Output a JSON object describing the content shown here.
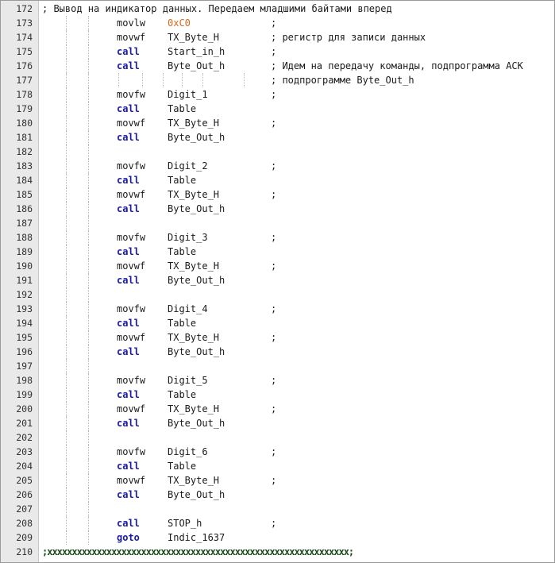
{
  "editor": {
    "accent_colors": {
      "keyword": "#1a1aa6",
      "hex_literal": "#d2691e"
    },
    "lines": [
      {
        "n": "172",
        "full": "; Вывод на индикатор данных. Передаем младшими байтами вперед"
      },
      {
        "n": "173",
        "i": "movlw",
        "o": "0xC0",
        "hex": true,
        "c": ";"
      },
      {
        "n": "174",
        "i": "movwf",
        "o": "TX_Byte_H",
        "c": "; регистр для записи данных"
      },
      {
        "n": "175",
        "i": "call",
        "o": "Start_in_h",
        "c": ";"
      },
      {
        "n": "176",
        "i": "call",
        "o": "Byte_Out_h",
        "c": "; Идем на передачу команды, подпрограмма АСК"
      },
      {
        "n": "177",
        "guides": true,
        "c": "; подпрограмме Byte_Out_h"
      },
      {
        "n": "178",
        "i": "movfw",
        "o": "Digit_1",
        "c": ";"
      },
      {
        "n": "179",
        "i": "call",
        "o": "Table"
      },
      {
        "n": "180",
        "i": "movwf",
        "o": "TX_Byte_H",
        "c": ";"
      },
      {
        "n": "181",
        "i": "call",
        "o": "Byte_Out_h"
      },
      {
        "n": "182"
      },
      {
        "n": "183",
        "i": "movfw",
        "o": "Digit_2",
        "c": ";"
      },
      {
        "n": "184",
        "i": "call",
        "o": "Table"
      },
      {
        "n": "185",
        "i": "movwf",
        "o": "TX_Byte_H",
        "c": ";"
      },
      {
        "n": "186",
        "i": "call",
        "o": "Byte_Out_h"
      },
      {
        "n": "187"
      },
      {
        "n": "188",
        "i": "movfw",
        "o": "Digit_3",
        "c": ";"
      },
      {
        "n": "189",
        "i": "call",
        "o": "Table"
      },
      {
        "n": "190",
        "i": "movwf",
        "o": "TX_Byte_H",
        "c": ";"
      },
      {
        "n": "191",
        "i": "call",
        "o": "Byte_Out_h"
      },
      {
        "n": "192"
      },
      {
        "n": "193",
        "i": "movfw",
        "o": "Digit_4",
        "c": ";"
      },
      {
        "n": "194",
        "i": "call",
        "o": "Table"
      },
      {
        "n": "195",
        "i": "movwf",
        "o": "TX_Byte_H",
        "c": ";"
      },
      {
        "n": "196",
        "i": "call",
        "o": "Byte_Out_h"
      },
      {
        "n": "197"
      },
      {
        "n": "198",
        "i": "movfw",
        "o": "Digit_5",
        "c": ";"
      },
      {
        "n": "199",
        "i": "call",
        "o": "Table"
      },
      {
        "n": "200",
        "i": "movwf",
        "o": "TX_Byte_H",
        "c": ";"
      },
      {
        "n": "201",
        "i": "call",
        "o": "Byte_Out_h"
      },
      {
        "n": "202"
      },
      {
        "n": "203",
        "i": "movfw",
        "o": "Digit_6",
        "c": ";"
      },
      {
        "n": "204",
        "i": "call",
        "o": "Table"
      },
      {
        "n": "205",
        "i": "movwf",
        "o": "TX_Byte_H",
        "c": ";"
      },
      {
        "n": "206",
        "i": "call",
        "o": "Byte_Out_h"
      },
      {
        "n": "207"
      },
      {
        "n": "208",
        "i": "call",
        "o": "STOP_h",
        "c": ";"
      },
      {
        "n": "209",
        "i": "goto",
        "o": "Indic_1637"
      },
      {
        "n": "210",
        "sep": ";xxxxxxxxxxxxxxxxxxxxxxxxxxxxxxxxxxxxxxxxxxxxxxxxxxxxxxxxxxxxx;"
      }
    ]
  }
}
